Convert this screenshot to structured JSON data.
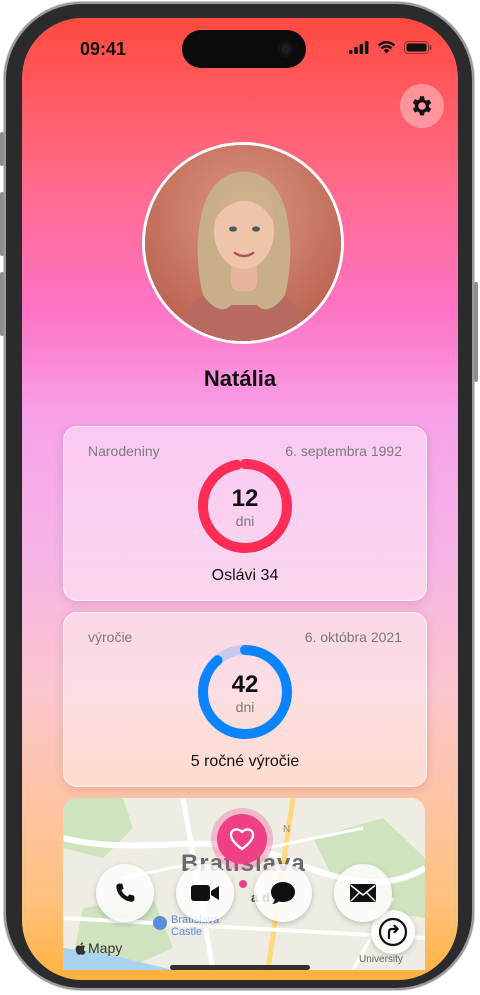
{
  "status": {
    "time": "09:41"
  },
  "profile": {
    "name": "Natália"
  },
  "birthday_card": {
    "label": "Narodeniny",
    "date": "6. septembra 1992",
    "days": "12",
    "unit": "dni",
    "caption": "Oslávi 34",
    "ring_color": "#ff2d55",
    "progress": 0.967
  },
  "anniversary_card": {
    "label": "výročie",
    "date": "6. októbra 2021",
    "days": "42",
    "unit": "dni",
    "caption": "5 ročné výročie",
    "ring_color": "#0a84ff",
    "progress": 0.885
  },
  "map": {
    "city": "Bratislava",
    "landmark": "Bratislava Castle",
    "pin_partial": "a d",
    "attribution": "Mapy",
    "top_partial": "N",
    "university_partial": "University"
  },
  "actions": [
    "phone",
    "video",
    "message",
    "mail"
  ],
  "icons": {
    "settings": "gear-icon",
    "phone": "phone-icon",
    "video": "video-camera-icon",
    "message": "speech-bubble-icon",
    "mail": "envelope-icon",
    "directions": "turn-right-arrow-icon",
    "pin": "heart-icon"
  }
}
